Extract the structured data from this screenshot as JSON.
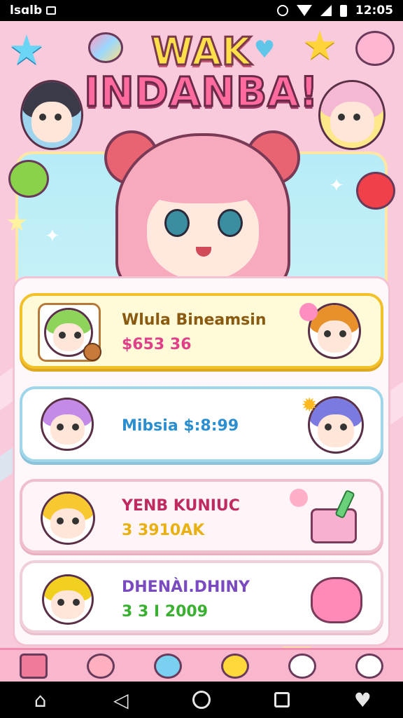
{
  "status_bar": {
    "left_text": "lsɑlb",
    "time": "12:05",
    "icons": [
      "camera-icon",
      "alarm-icon",
      "wifi-icon",
      "signal-icon",
      "battery-icon"
    ]
  },
  "header": {
    "title_line1": "WAK",
    "title_line2": "INDANBA!"
  },
  "cards": [
    {
      "name": "Wlula Bineamsin",
      "value": "$653 36",
      "name_color": "#8a5a10",
      "value_color": "#e0408a",
      "highlighted": true
    },
    {
      "name": "Mibsia $:8:99",
      "value": "",
      "name_color": "#2a8ed0",
      "value_color": "#2a8ed0",
      "highlighted": false
    },
    {
      "name": "YENB KUNIUC",
      "value": "3 3910AK",
      "name_color": "#c02a60",
      "value_color": "#e8b010",
      "highlighted": false
    },
    {
      "name": "DHENÀI.DHINY",
      "value": "3 3 I 2009",
      "name_color": "#7a4ac0",
      "value_color": "#3ab030",
      "highlighted": false
    }
  ],
  "tabbar": {
    "tabs": [
      "pencil-icon",
      "bunny-icon",
      "cloud-icon",
      "crown-icon",
      "bell-icon",
      "smiley-icon"
    ]
  },
  "colors": {
    "background": "#f9c9dc",
    "accent_pink": "#ff6b9e",
    "accent_yellow": "#ffe04a"
  }
}
